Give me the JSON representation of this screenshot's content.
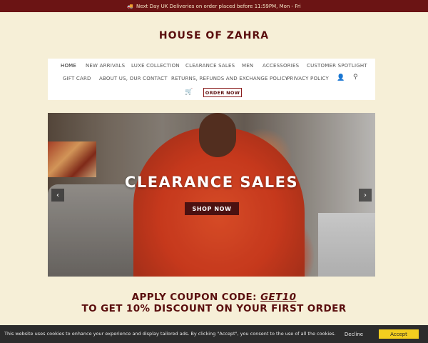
{
  "topbar": {
    "truck_icon": "truck-icon",
    "message": "Next Day UK Deliveries on order placed before 11:59PM, Mon - Fri"
  },
  "brand": {
    "name": "HOUSE OF ZAHRA"
  },
  "nav": {
    "items": [
      "HOME",
      "NEW ARRIVALS",
      "LUXE COLLECTION",
      "CLEARANCE SALES",
      "MEN",
      "ACCESSORIES",
      "CUSTOMER SPOTLIGHT",
      "GIFT CARD",
      "ABOUT US, OUR CONTACT",
      "RETURNS, REFUNDS AND EXCHANGE POLICY",
      "PRIVACY POLICY"
    ],
    "account_icon": "user-icon",
    "search_icon": "search-icon",
    "cart_icon": "cart-icon",
    "order_now": "ORDER NOW"
  },
  "hero": {
    "title": "CLEARANCE SALES",
    "button": "SHOP NOW",
    "prev_icon": "chevron-left-icon",
    "next_icon": "chevron-right-icon"
  },
  "coupon": {
    "line1_prefix": "APPLY COUPON CODE: ",
    "code": "GET10",
    "line2": "TO GET 10% DISCOUNT ON YOUR FIRST ORDER"
  },
  "cookie": {
    "text": "This website uses cookies to enhance your experience and display tailored ads. By clicking \"Accept\", you consent to the use of all the cookies.",
    "decline": "Decline",
    "accept": "Accept"
  },
  "colors": {
    "topbar": "#6b1414",
    "brand": "#5a0e0e",
    "background": "#f6efd7",
    "accept": "#f2cd1f"
  }
}
